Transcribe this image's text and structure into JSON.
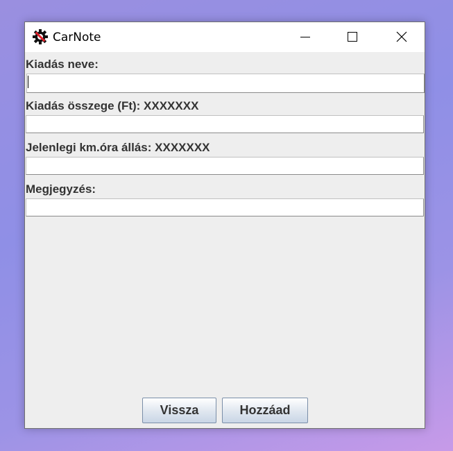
{
  "window": {
    "title": "CarNote",
    "app_icon": "gear-wrench-icon",
    "controls": [
      "minimize-icon",
      "maximize-icon",
      "close-icon"
    ]
  },
  "form": {
    "fields": [
      {
        "label": "Kiadás neve:",
        "value": ""
      },
      {
        "label": "Kiadás összege (Ft): XXXXXXX",
        "value": ""
      },
      {
        "label": "Jelenlegi km.óra állás: XXXXXXX",
        "value": ""
      },
      {
        "label": "Megjegyzés:",
        "value": ""
      }
    ]
  },
  "buttons": {
    "back_label": "Vissza",
    "add_label": "Hozzáad"
  },
  "colors": {
    "window_bg": "#eeeeee",
    "titlebar_bg": "#ffffff",
    "icon_red": "#e0202a",
    "label_text": "#333333"
  }
}
